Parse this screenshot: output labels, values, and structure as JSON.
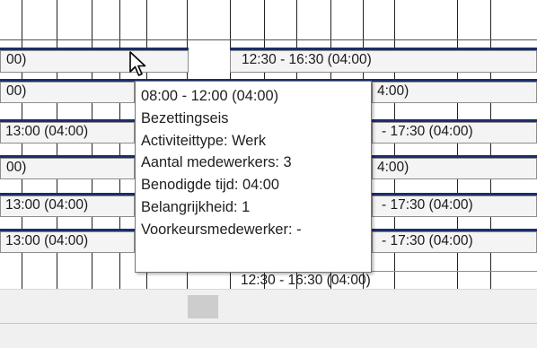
{
  "schedule": {
    "rows": [
      {
        "left": "00)",
        "right": "12:30 - 16:30 (04:00)"
      },
      {
        "left": "00)",
        "right": "4:00)"
      },
      {
        "left": "13:00 (04:00)",
        "right": "- 17:30 (04:00)"
      },
      {
        "left": "00)",
        "right": "4:00)"
      },
      {
        "left": "13:00 (04:00)",
        "right": "- 17:30 (04:00)"
      },
      {
        "left": "13:00 (04:00)",
        "right": "- 17:30 (04:00)"
      },
      {
        "left": "",
        "right": "12:30 - 16:30 (04:00)"
      }
    ]
  },
  "tooltip": {
    "lines": [
      "08:00 - 12:00 (04:00)",
      "Bezettingseis",
      "Activiteittype:  Werk",
      "Aantal medewerkers: 3",
      "Benodigde tijd: 04:00",
      "Belangrijkheid: 1",
      "Voorkeursmedewerker: -"
    ]
  },
  "colors": {
    "grid_line": "#222222",
    "shift_bar_top": "#1b2d6b",
    "cell_bg": "#f4f4f4",
    "scrollbar_bg": "#f0f0f0",
    "scroll_thumb": "#cdcdcd"
  },
  "icons": [
    "mouse-cursor-icon"
  ]
}
